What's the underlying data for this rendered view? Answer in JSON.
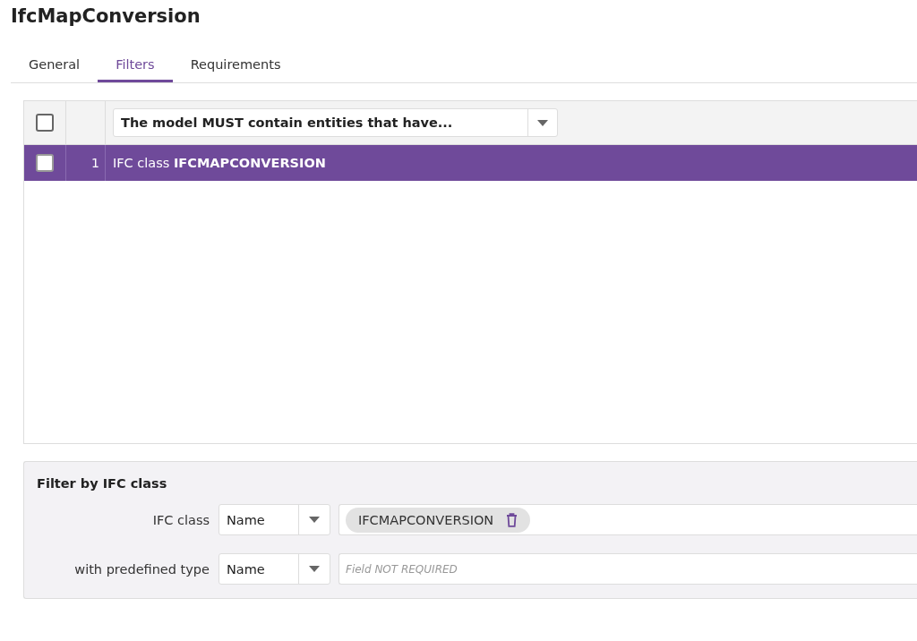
{
  "title": "IfcMapConversion",
  "tabs": [
    {
      "label": "General",
      "selected": false
    },
    {
      "label": "Filters",
      "selected": true
    },
    {
      "label": "Requirements",
      "selected": false
    }
  ],
  "grid": {
    "header_checked": false,
    "header_select": "The model MUST contain entities that have...",
    "rows": [
      {
        "checked": false,
        "selected": true,
        "number": "1",
        "text": "IFC class **IFCMAPCONVERSION**"
      }
    ]
  },
  "panel": {
    "title": "Filter by IFC class",
    "fields": [
      {
        "kind": "tag",
        "label": "IFC class",
        "mode": "Name",
        "value": "IFCMAPCONVERSION"
      },
      {
        "kind": "text",
        "label": "with predefined type",
        "mode": "Name",
        "placeholder": "Field NOT REQUIRED"
      }
    ]
  }
}
